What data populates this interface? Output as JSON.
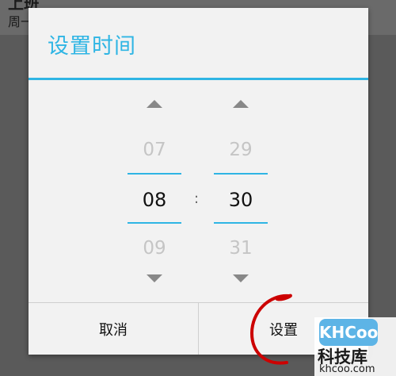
{
  "background": {
    "title": "上班",
    "subtitle": "周一"
  },
  "dialog": {
    "title": "设置时间",
    "hour": {
      "prev": "07",
      "current": "08",
      "next": "09"
    },
    "separator": ":",
    "minute": {
      "prev": "29",
      "current": "30",
      "next": "31"
    },
    "cancel_label": "取消",
    "set_label": "设置"
  },
  "watermark": {
    "logo": "KHCoo",
    "name": "科技库",
    "url": "khcoo.com"
  },
  "colors": {
    "accent": "#2fb5e4",
    "annotation": "#cc0000"
  },
  "icons": [
    "chevron-up-icon",
    "chevron-down-icon"
  ]
}
